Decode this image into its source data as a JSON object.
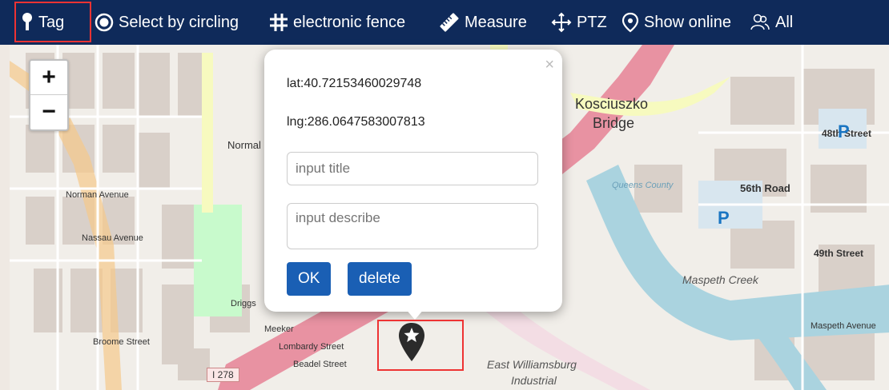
{
  "toolbar": {
    "items": [
      {
        "label": "Tag",
        "icon": "pin-icon"
      },
      {
        "label": "Select by circling",
        "icon": "circle-select-icon"
      },
      {
        "label": "electronic fence",
        "icon": "grid-icon"
      },
      {
        "label": "Measure",
        "icon": "ruler-icon"
      },
      {
        "label": "PTZ",
        "icon": "move-arrows-icon"
      },
      {
        "label": "Show online",
        "icon": "location-icon"
      },
      {
        "label": "All",
        "icon": "people-icon"
      }
    ]
  },
  "zoom": {
    "in": "+",
    "out": "−"
  },
  "popup": {
    "close": "×",
    "lat": "lat:40.72153460029748",
    "lng": "lng:286.0647583007813",
    "title_placeholder": "input title",
    "describe_placeholder": "input describe",
    "ok": "OK",
    "delete": "delete"
  },
  "map": {
    "labels": [
      "Kosciuszko",
      "Bridge",
      "Maspeth Creek",
      "East Williamsburg",
      "Industrial",
      "I 278",
      "Normal",
      "56th Road",
      "48th Street",
      "49th Street",
      "Queens County",
      "Maspeth Avenue",
      "Norman Avenue",
      "Nassau Avenue",
      "Meeker",
      "Lombardy Street",
      "Beadel Street",
      "Broome Street",
      "Driggs"
    ],
    "parking": "P",
    "colors": {
      "water": "#aad3df",
      "highway": "#e892a2",
      "major_road": "#f7fabf",
      "block": "#d9d0c9",
      "park": "#c8facc"
    }
  }
}
